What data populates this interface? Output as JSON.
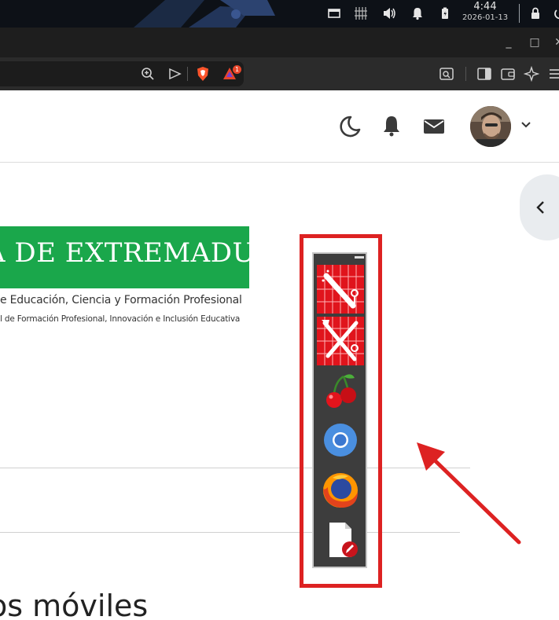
{
  "system_bar": {
    "time": "4:44",
    "date": "2026-01-13",
    "icons": [
      "window-icon",
      "keyboard-layout-icon",
      "volume-icon",
      "notifications-icon",
      "battery-icon",
      "lock-icon",
      "power-icon"
    ]
  },
  "window": {
    "minimize_label": "_",
    "maximize_label": "□",
    "close_label": "✕"
  },
  "toolbar": {
    "notification_count": "1",
    "icons": [
      "zoom-icon",
      "send-icon",
      "brave-shield-icon",
      "brave-rewards-icon",
      "screenshot-icon",
      "sidebar-icon",
      "wallet-icon",
      "leo-ai-icon"
    ]
  },
  "page": {
    "header_icons": [
      "moon-icon",
      "bell-icon",
      "envelope-icon",
      "avatar",
      "chevron-down-icon"
    ],
    "banner_text": "A DE EXTREMADURA",
    "subtitle_1": "e Educación, Ciencia y Formación Profesional",
    "subtitle_2": "l de Formación Profesional, Innovación e Inclusión Educativa",
    "bottom_heading": "os móviles",
    "side_toggle_icon": "chevron-left-icon"
  },
  "dock": {
    "items": [
      {
        "name": "tools-app-1",
        "icon": "ruler-pencil-tool-icon"
      },
      {
        "name": "tools-app-2",
        "icon": "crossed-tools-icon"
      },
      {
        "name": "cherry-app",
        "icon": "cherry-icon"
      },
      {
        "name": "chromium-app",
        "icon": "chromium-icon"
      },
      {
        "name": "firefox-app",
        "icon": "firefox-icon"
      },
      {
        "name": "text-editor-app",
        "icon": "document-edit-icon"
      }
    ]
  },
  "colors": {
    "banner_green": "#1aa74b",
    "highlight_red": "#dd2222",
    "dock_bg": "#3d3d3d"
  }
}
